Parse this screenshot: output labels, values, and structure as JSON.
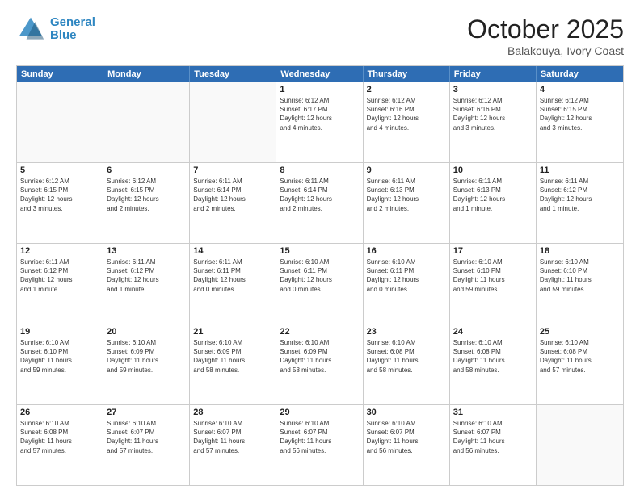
{
  "header": {
    "logo_line1": "General",
    "logo_line2": "Blue",
    "month": "October 2025",
    "location": "Balakouya, Ivory Coast"
  },
  "weekdays": [
    "Sunday",
    "Monday",
    "Tuesday",
    "Wednesday",
    "Thursday",
    "Friday",
    "Saturday"
  ],
  "weeks": [
    [
      {
        "day": "",
        "info": ""
      },
      {
        "day": "",
        "info": ""
      },
      {
        "day": "",
        "info": ""
      },
      {
        "day": "1",
        "info": "Sunrise: 6:12 AM\nSunset: 6:17 PM\nDaylight: 12 hours\nand 4 minutes."
      },
      {
        "day": "2",
        "info": "Sunrise: 6:12 AM\nSunset: 6:16 PM\nDaylight: 12 hours\nand 4 minutes."
      },
      {
        "day": "3",
        "info": "Sunrise: 6:12 AM\nSunset: 6:16 PM\nDaylight: 12 hours\nand 3 minutes."
      },
      {
        "day": "4",
        "info": "Sunrise: 6:12 AM\nSunset: 6:15 PM\nDaylight: 12 hours\nand 3 minutes."
      }
    ],
    [
      {
        "day": "5",
        "info": "Sunrise: 6:12 AM\nSunset: 6:15 PM\nDaylight: 12 hours\nand 3 minutes."
      },
      {
        "day": "6",
        "info": "Sunrise: 6:12 AM\nSunset: 6:15 PM\nDaylight: 12 hours\nand 2 minutes."
      },
      {
        "day": "7",
        "info": "Sunrise: 6:11 AM\nSunset: 6:14 PM\nDaylight: 12 hours\nand 2 minutes."
      },
      {
        "day": "8",
        "info": "Sunrise: 6:11 AM\nSunset: 6:14 PM\nDaylight: 12 hours\nand 2 minutes."
      },
      {
        "day": "9",
        "info": "Sunrise: 6:11 AM\nSunset: 6:13 PM\nDaylight: 12 hours\nand 2 minutes."
      },
      {
        "day": "10",
        "info": "Sunrise: 6:11 AM\nSunset: 6:13 PM\nDaylight: 12 hours\nand 1 minute."
      },
      {
        "day": "11",
        "info": "Sunrise: 6:11 AM\nSunset: 6:12 PM\nDaylight: 12 hours\nand 1 minute."
      }
    ],
    [
      {
        "day": "12",
        "info": "Sunrise: 6:11 AM\nSunset: 6:12 PM\nDaylight: 12 hours\nand 1 minute."
      },
      {
        "day": "13",
        "info": "Sunrise: 6:11 AM\nSunset: 6:12 PM\nDaylight: 12 hours\nand 1 minute."
      },
      {
        "day": "14",
        "info": "Sunrise: 6:11 AM\nSunset: 6:11 PM\nDaylight: 12 hours\nand 0 minutes."
      },
      {
        "day": "15",
        "info": "Sunrise: 6:10 AM\nSunset: 6:11 PM\nDaylight: 12 hours\nand 0 minutes."
      },
      {
        "day": "16",
        "info": "Sunrise: 6:10 AM\nSunset: 6:11 PM\nDaylight: 12 hours\nand 0 minutes."
      },
      {
        "day": "17",
        "info": "Sunrise: 6:10 AM\nSunset: 6:10 PM\nDaylight: 11 hours\nand 59 minutes."
      },
      {
        "day": "18",
        "info": "Sunrise: 6:10 AM\nSunset: 6:10 PM\nDaylight: 11 hours\nand 59 minutes."
      }
    ],
    [
      {
        "day": "19",
        "info": "Sunrise: 6:10 AM\nSunset: 6:10 PM\nDaylight: 11 hours\nand 59 minutes."
      },
      {
        "day": "20",
        "info": "Sunrise: 6:10 AM\nSunset: 6:09 PM\nDaylight: 11 hours\nand 59 minutes."
      },
      {
        "day": "21",
        "info": "Sunrise: 6:10 AM\nSunset: 6:09 PM\nDaylight: 11 hours\nand 58 minutes."
      },
      {
        "day": "22",
        "info": "Sunrise: 6:10 AM\nSunset: 6:09 PM\nDaylight: 11 hours\nand 58 minutes."
      },
      {
        "day": "23",
        "info": "Sunrise: 6:10 AM\nSunset: 6:08 PM\nDaylight: 11 hours\nand 58 minutes."
      },
      {
        "day": "24",
        "info": "Sunrise: 6:10 AM\nSunset: 6:08 PM\nDaylight: 11 hours\nand 58 minutes."
      },
      {
        "day": "25",
        "info": "Sunrise: 6:10 AM\nSunset: 6:08 PM\nDaylight: 11 hours\nand 57 minutes."
      }
    ],
    [
      {
        "day": "26",
        "info": "Sunrise: 6:10 AM\nSunset: 6:08 PM\nDaylight: 11 hours\nand 57 minutes."
      },
      {
        "day": "27",
        "info": "Sunrise: 6:10 AM\nSunset: 6:07 PM\nDaylight: 11 hours\nand 57 minutes."
      },
      {
        "day": "28",
        "info": "Sunrise: 6:10 AM\nSunset: 6:07 PM\nDaylight: 11 hours\nand 57 minutes."
      },
      {
        "day": "29",
        "info": "Sunrise: 6:10 AM\nSunset: 6:07 PM\nDaylight: 11 hours\nand 56 minutes."
      },
      {
        "day": "30",
        "info": "Sunrise: 6:10 AM\nSunset: 6:07 PM\nDaylight: 11 hours\nand 56 minutes."
      },
      {
        "day": "31",
        "info": "Sunrise: 6:10 AM\nSunset: 6:07 PM\nDaylight: 11 hours\nand 56 minutes."
      },
      {
        "day": "",
        "info": ""
      }
    ]
  ]
}
